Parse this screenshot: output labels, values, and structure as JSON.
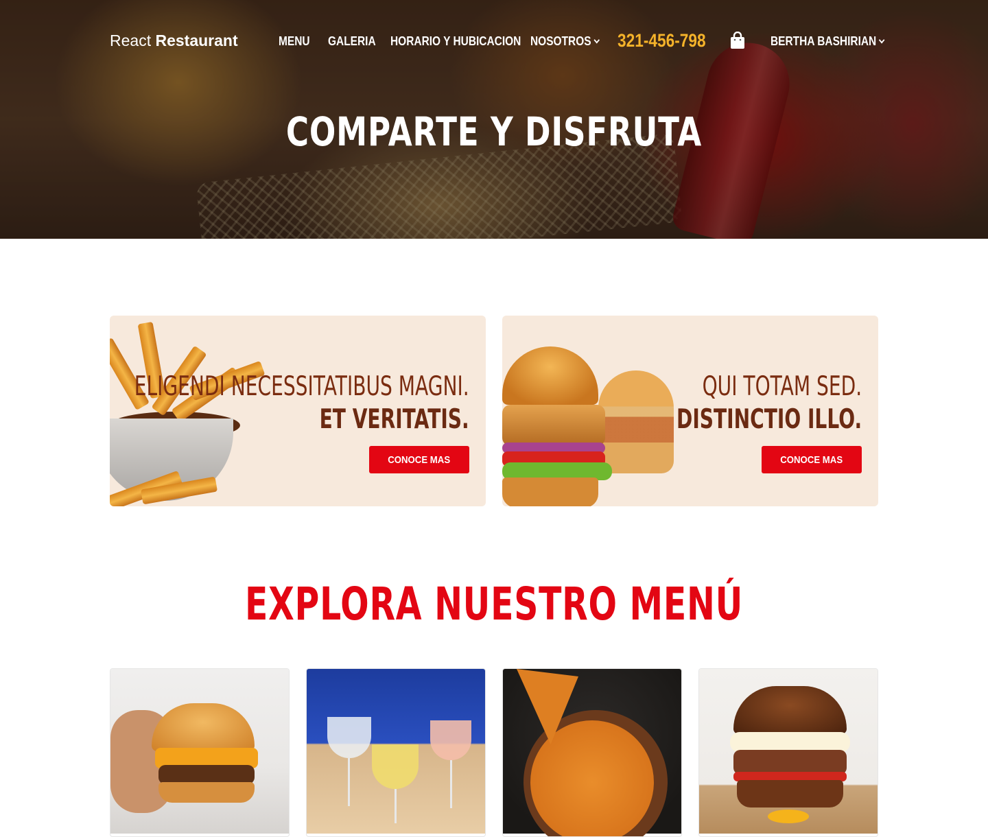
{
  "brand": {
    "light": "React",
    "strong": "Restaurant"
  },
  "nav": {
    "items": [
      {
        "label": "MENU"
      },
      {
        "label": "GALERIA"
      },
      {
        "label": "HORARIO Y HUBICACION"
      },
      {
        "label": "NOSOTROS"
      }
    ],
    "phone": "321-456-798",
    "user": "BERTHA BASHIRIAN"
  },
  "hero": {
    "title": "COMPARTE Y DISFRUTA"
  },
  "promos": [
    {
      "line1": "ELIGENDI NECESSITATIBUS MAGNI.",
      "line2": "ET VERITATIS.",
      "button": "CONOCE MAS"
    },
    {
      "line1": "QUI TOTAM SED.",
      "line2": "DISTINCTIO ILLO.",
      "button": "CONOCE MAS"
    }
  ],
  "menu": {
    "title": "EXPLORA NUESTRO MENÚ"
  },
  "colors": {
    "accent": "#e30613",
    "phone": "#f5b32a",
    "promo_bg": "#f7e9dc",
    "promo_text": "#7a2c10"
  }
}
